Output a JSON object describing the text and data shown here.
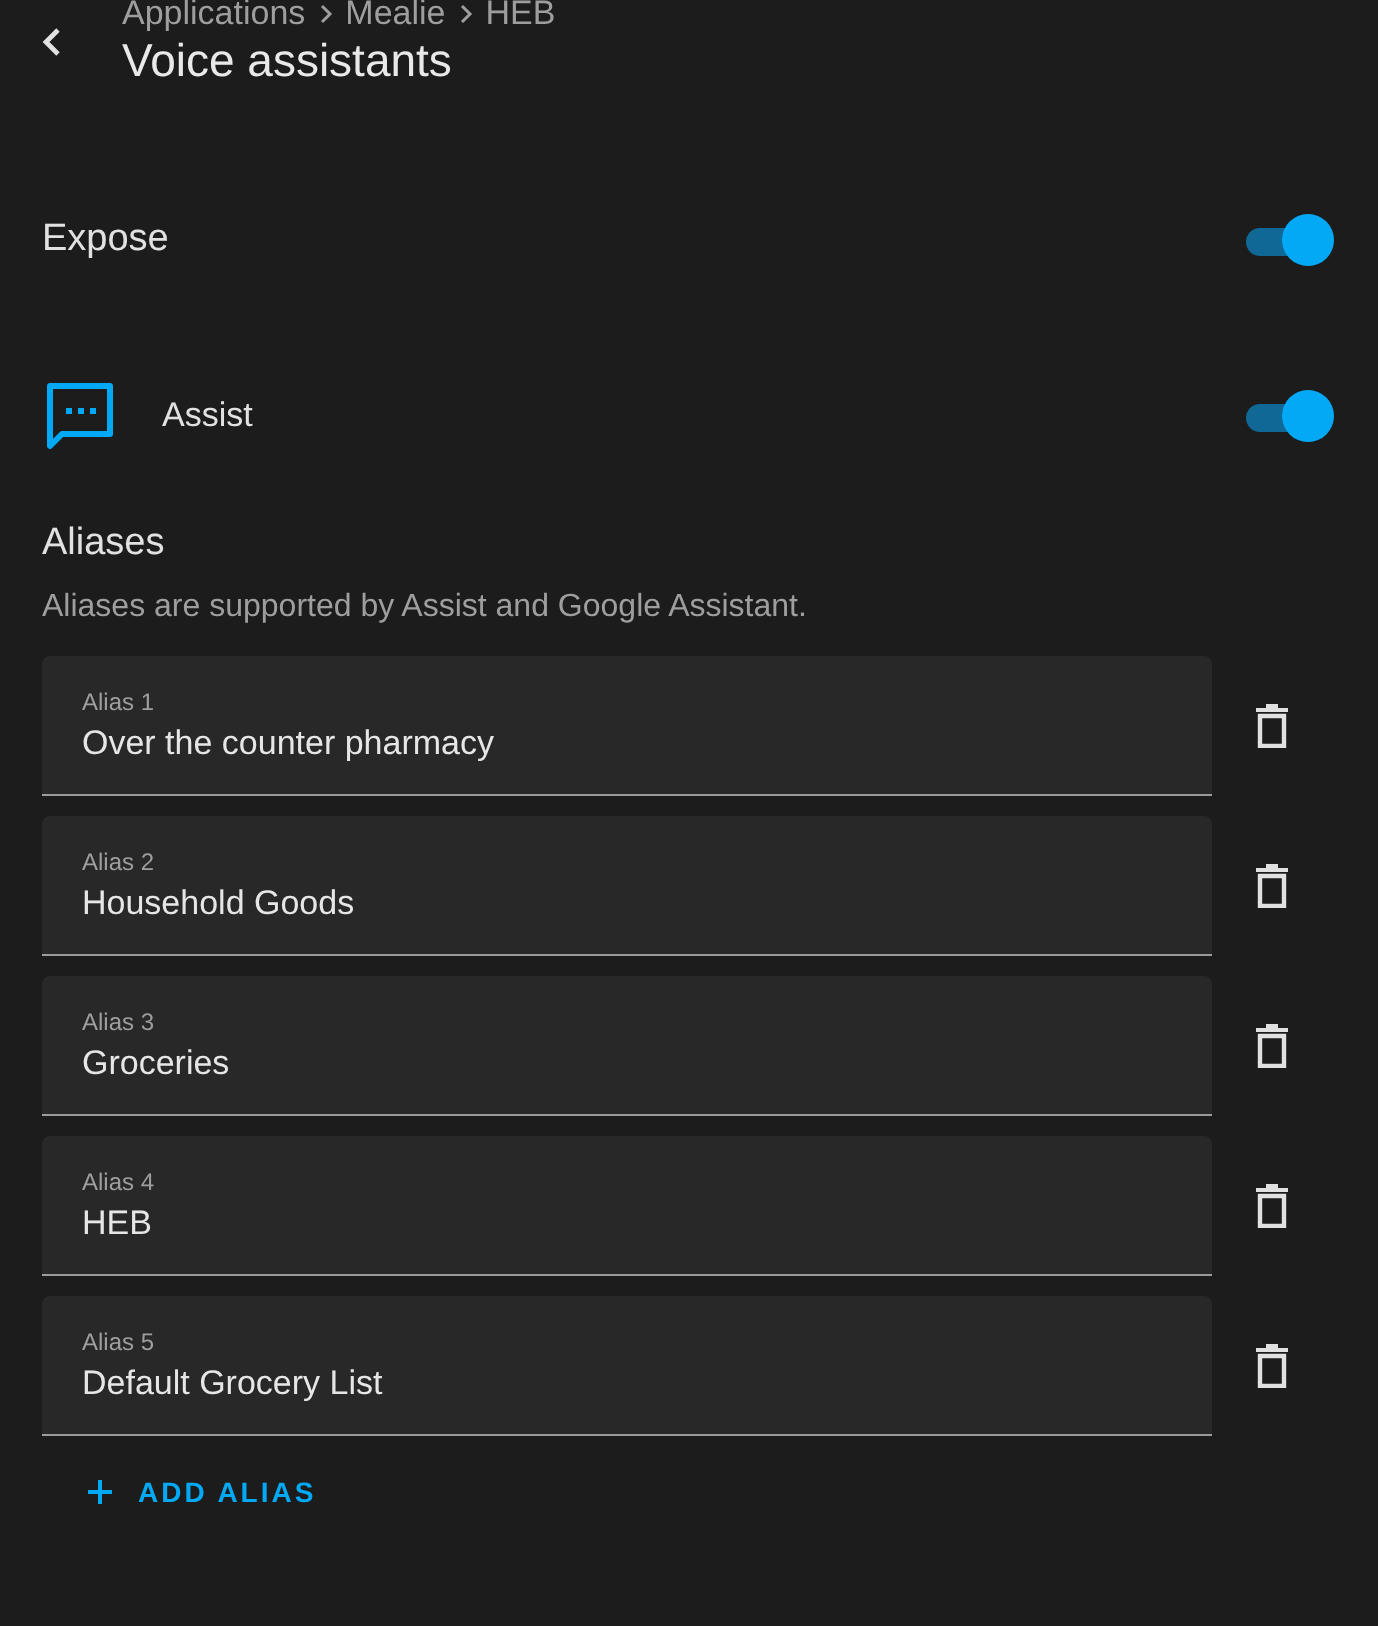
{
  "header": {
    "breadcrumb": [
      "Applications",
      "Mealie",
      "HEB"
    ],
    "title": "Voice assistants"
  },
  "expose": {
    "label": "Expose",
    "on": true
  },
  "assistants": [
    {
      "label": "Assist",
      "on": true
    }
  ],
  "aliases": {
    "title": "Aliases",
    "description": "Aliases are supported by Assist and Google Assistant.",
    "fields": [
      {
        "label": "Alias 1",
        "value": "Over the counter pharmacy"
      },
      {
        "label": "Alias 2",
        "value": "Household Goods"
      },
      {
        "label": "Alias 3",
        "value": "Groceries"
      },
      {
        "label": "Alias 4",
        "value": "HEB"
      },
      {
        "label": "Alias 5",
        "value": "Default Grocery List"
      }
    ],
    "add_button": "ADD ALIAS"
  }
}
